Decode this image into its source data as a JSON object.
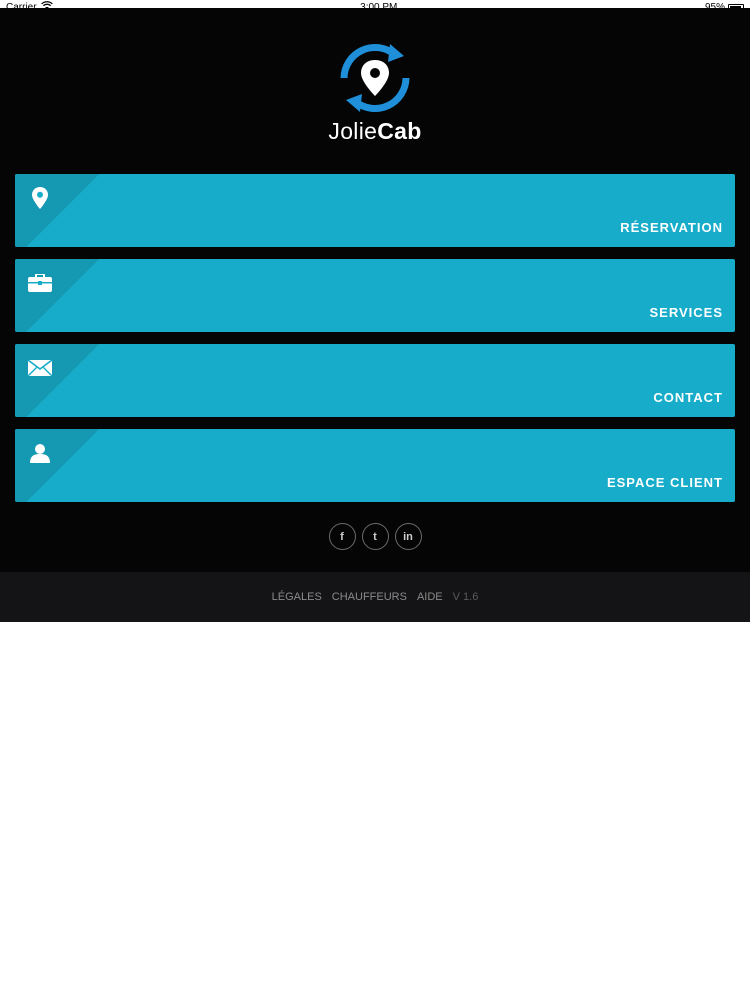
{
  "status_bar": {
    "carrier": "Carrier",
    "time": "3:00 PM",
    "battery": "95%"
  },
  "brand": {
    "name_light": "Jolie",
    "name_bold": "Cab",
    "accent_color": "#1e8fd8"
  },
  "menu": [
    {
      "label": "RÉSERVATION",
      "icon": "location-pin-icon"
    },
    {
      "label": "SERVICES",
      "icon": "briefcase-icon"
    },
    {
      "label": "CONTACT",
      "icon": "envelope-icon"
    },
    {
      "label": "ESPACE CLIENT",
      "icon": "user-icon"
    }
  ],
  "social": {
    "facebook": "f",
    "twitter": "t",
    "linkedin": "in"
  },
  "footer": {
    "legal": "LÉGALES",
    "drivers": "CHAUFFEURS",
    "help": "AIDE",
    "version": "V 1.6"
  },
  "colors": {
    "tile": "#17acc9",
    "background": "#050505",
    "footer": "#141416"
  }
}
